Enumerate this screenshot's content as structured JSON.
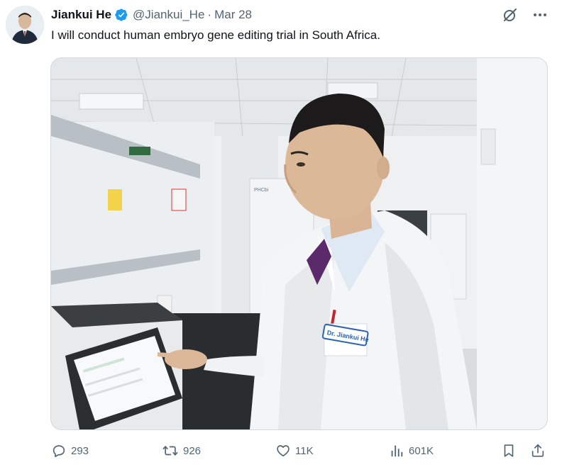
{
  "tweet": {
    "author_name": "Jiankui He",
    "handle": "@Jiankui_He",
    "separator": "·",
    "date": "Mar 28",
    "text": "I will conduct human embryo gene editing trial in South Africa."
  },
  "media": {
    "badge_text": "Dr. Jiankui He",
    "brand_text": "PHCbi"
  },
  "actions": {
    "replies": "293",
    "retweets": "926",
    "likes": "11K",
    "views": "601K"
  },
  "icons": {
    "verified": "verified-badge-icon",
    "grok": "grok-icon",
    "more": "more-icon",
    "reply": "reply-icon",
    "retweet": "retweet-icon",
    "like": "heart-icon",
    "views": "views-chart-icon",
    "bookmark": "bookmark-icon",
    "share": "share-icon"
  },
  "colors": {
    "text_primary": "#0f1419",
    "text_secondary": "#536471",
    "verified_blue": "#1d9bf0",
    "border": "#cfd9de"
  }
}
